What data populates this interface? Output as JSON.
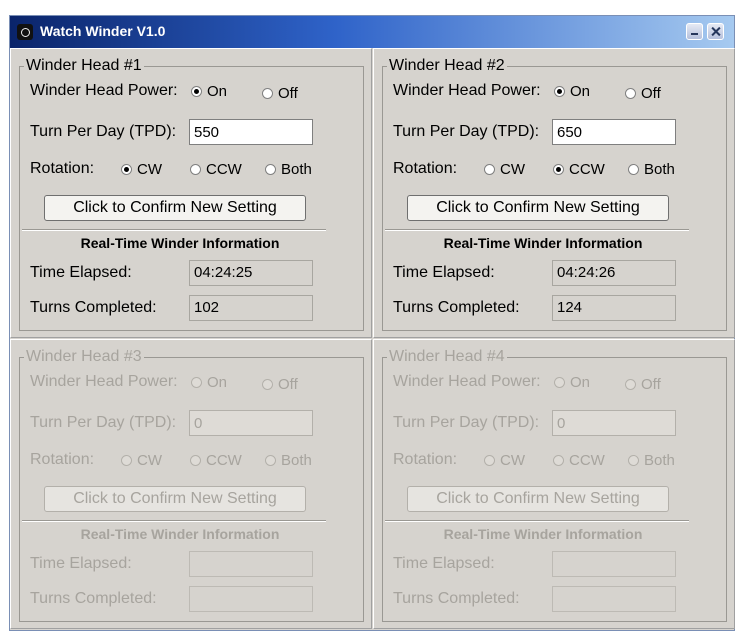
{
  "window": {
    "title": "Watch Winder V1.0"
  },
  "labels": {
    "power": "Winder Head Power:",
    "tpd": "Turn Per Day (TPD):",
    "rotation": "Rotation:",
    "on": "On",
    "off": "Off",
    "cw": "CW",
    "ccw": "CCW",
    "both": "Both",
    "confirm_button": "Click to Confirm New Setting",
    "info_title": "Real-Time Winder Information",
    "time_elapsed": "Time Elapsed:",
    "turns_completed": "Turns Completed:"
  },
  "heads": [
    {
      "title": "Winder Head #1",
      "enabled": true,
      "power": "on",
      "tpd": "550",
      "rotation": "cw",
      "time_elapsed": "04:24:25",
      "turns_completed": "102"
    },
    {
      "title": "Winder Head #2",
      "enabled": true,
      "power": "on",
      "tpd": "650",
      "rotation": "ccw",
      "time_elapsed": "04:24:26",
      "turns_completed": "124"
    },
    {
      "title": "Winder Head #3",
      "enabled": false,
      "power": "",
      "tpd": "0",
      "rotation": "",
      "time_elapsed": "",
      "turns_completed": ""
    },
    {
      "title": "Winder Head #4",
      "enabled": false,
      "power": "",
      "tpd": "0",
      "rotation": "",
      "time_elapsed": "",
      "turns_completed": ""
    }
  ]
}
